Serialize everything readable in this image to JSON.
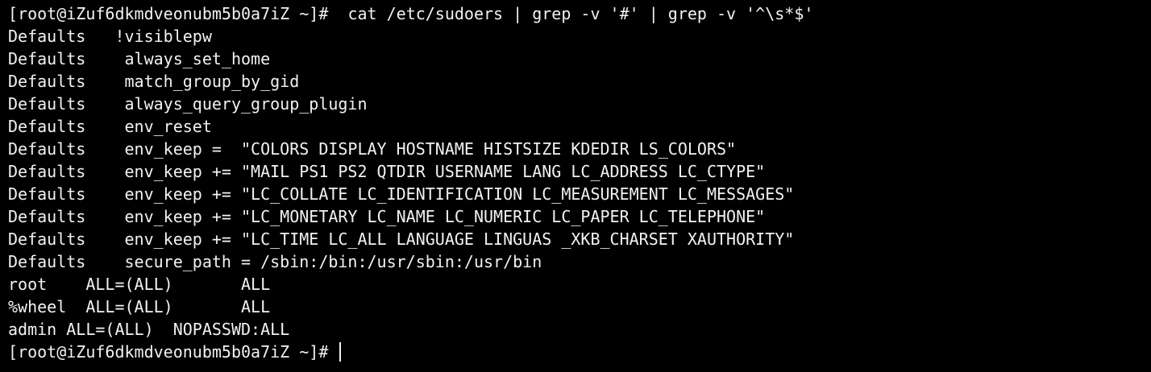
{
  "terminal": {
    "prompt": "[root@iZuf6dkmdveonubm5b0a7iZ ~]#",
    "command": "  cat /etc/sudoers | grep -v '#' | grep -v '^\\s*$'",
    "output": [
      "Defaults   !visiblepw",
      "Defaults    always_set_home",
      "Defaults    match_group_by_gid",
      "Defaults    always_query_group_plugin",
      "Defaults    env_reset",
      "Defaults    env_keep =  \"COLORS DISPLAY HOSTNAME HISTSIZE KDEDIR LS_COLORS\"",
      "Defaults    env_keep += \"MAIL PS1 PS2 QTDIR USERNAME LANG LC_ADDRESS LC_CTYPE\"",
      "Defaults    env_keep += \"LC_COLLATE LC_IDENTIFICATION LC_MEASUREMENT LC_MESSAGES\"",
      "Defaults    env_keep += \"LC_MONETARY LC_NAME LC_NUMERIC LC_PAPER LC_TELEPHONE\"",
      "Defaults    env_keep += \"LC_TIME LC_ALL LANGUAGE LINGUAS _XKB_CHARSET XAUTHORITY\"",
      "Defaults    secure_path = /sbin:/bin:/usr/sbin:/usr/bin",
      "root    ALL=(ALL)       ALL",
      "%wheel  ALL=(ALL)       ALL",
      "admin ALL=(ALL)  NOPASSWD:ALL"
    ],
    "final_prompt": "[root@iZuf6dkmdveonubm5b0a7iZ ~]# "
  },
  "colors": {
    "background": "#000000",
    "text": "#f2f2f2"
  }
}
